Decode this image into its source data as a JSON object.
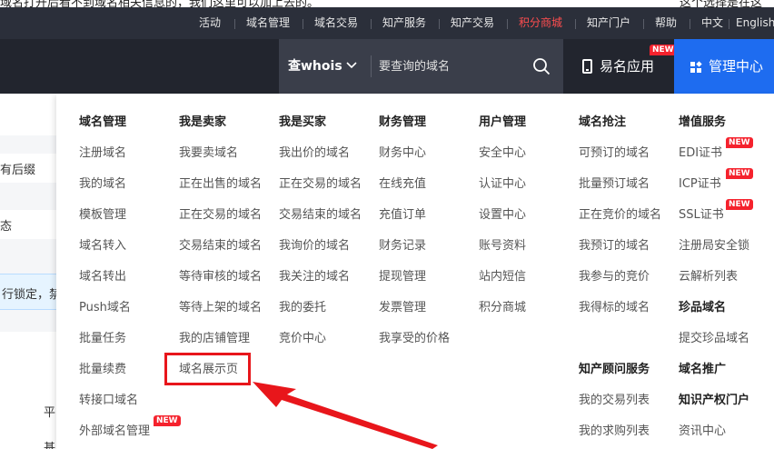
{
  "top_strip": {
    "left_text": "域名打开后看不到域名相关信息的，我们这里可以加上去的。",
    "right_text": "这个选择是在这"
  },
  "topnav": {
    "items": [
      {
        "label": "活动",
        "highlight": false
      },
      {
        "label": "域名管理",
        "highlight": false
      },
      {
        "label": "域名交易",
        "highlight": false
      },
      {
        "label": "知产服务",
        "highlight": false
      },
      {
        "label": "知产交易",
        "highlight": false
      },
      {
        "label": "积分商城",
        "highlight": true
      },
      {
        "label": "知产门户",
        "highlight": false
      },
      {
        "label": "帮助",
        "highlight": false
      },
      {
        "label": "中文",
        "highlight": false
      },
      {
        "label": "English",
        "highlight": false
      }
    ]
  },
  "mainbar": {
    "search_type": "查whois",
    "search_placeholder": "要查询的域名",
    "app_label": "易名应用",
    "app_badge": "NEW",
    "mgmt_label": "管理中心"
  },
  "background_page": {
    "row1": "有后缀",
    "row2": "态",
    "notice": "行锁定，禁",
    "right_a": "平",
    "right_b": "基"
  },
  "menu": {
    "columns": [
      {
        "header": "域名管理",
        "items": [
          {
            "label": "注册域名"
          },
          {
            "label": "我的域名"
          },
          {
            "label": "模板管理"
          },
          {
            "label": "域名转入"
          },
          {
            "label": "域名转出"
          },
          {
            "label": "Push域名"
          },
          {
            "label": "批量任务"
          },
          {
            "label": "批量续费"
          },
          {
            "label": "转接口域名"
          },
          {
            "label": "外部域名管理",
            "badge": "NEW"
          }
        ]
      },
      {
        "header": "我是卖家",
        "items": [
          {
            "label": "我要卖域名"
          },
          {
            "label": "正在出售的域名"
          },
          {
            "label": "正在交易的域名"
          },
          {
            "label": "交易结束的域名"
          },
          {
            "label": "等待审核的域名"
          },
          {
            "label": "等待上架的域名"
          },
          {
            "label": "我的店铺管理"
          },
          {
            "label": "域名展示页"
          }
        ]
      },
      {
        "header": "我是买家",
        "items": [
          {
            "label": "我出价的域名"
          },
          {
            "label": "正在交易的域名"
          },
          {
            "label": "交易结束的域名"
          },
          {
            "label": "我询价的域名"
          },
          {
            "label": "我关注的域名"
          },
          {
            "label": "我的委托"
          },
          {
            "label": "竞价中心"
          }
        ]
      },
      {
        "header": "财务管理",
        "items": [
          {
            "label": "财务中心"
          },
          {
            "label": "在线充值"
          },
          {
            "label": "充值订单"
          },
          {
            "label": "财务记录"
          },
          {
            "label": "提现管理"
          },
          {
            "label": "发票管理"
          },
          {
            "label": "我享受的价格"
          }
        ]
      },
      {
        "header": "用户管理",
        "items": [
          {
            "label": "安全中心"
          },
          {
            "label": "认证中心"
          },
          {
            "label": "设置中心"
          },
          {
            "label": "账号资料"
          },
          {
            "label": "站内短信"
          },
          {
            "label": "积分商城"
          }
        ]
      },
      {
        "header": "域名抢注",
        "items": [
          {
            "label": "可预订的域名"
          },
          {
            "label": "批量预订域名"
          },
          {
            "label": "正在竞价的域名"
          },
          {
            "label": "我预订的域名"
          },
          {
            "label": "我参与的竞价"
          },
          {
            "label": "我得标的域名"
          }
        ],
        "header2": "知产顾问服务",
        "items2": [
          {
            "label": "我的交易列表"
          },
          {
            "label": "我的求购列表"
          }
        ]
      },
      {
        "header": "增值服务",
        "items": [
          {
            "label": "EDI证书",
            "badge": "NEW"
          },
          {
            "label": "ICP证书",
            "badge": "NEW"
          },
          {
            "label": "SSL证书",
            "badge": "NEW"
          },
          {
            "label": "注册局安全锁"
          },
          {
            "label": "云解析列表"
          }
        ],
        "header2": "珍品域名",
        "items2": [
          {
            "label": "提交珍品域名"
          }
        ],
        "header3": "域名推广",
        "header4": "知识产权门户",
        "items4": [
          {
            "label": "资讯中心"
          }
        ]
      }
    ]
  },
  "annotation": {
    "highlight_color": "#e8161b"
  }
}
